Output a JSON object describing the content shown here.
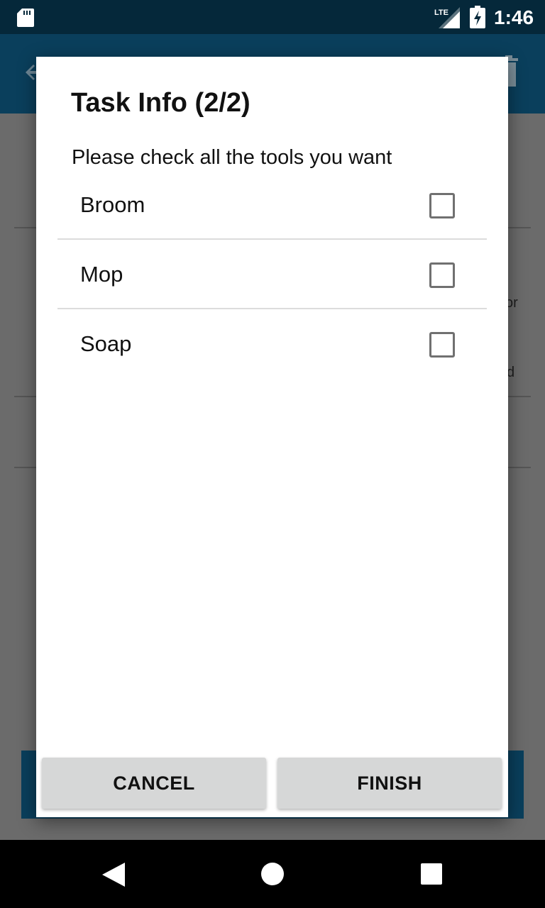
{
  "status_bar": {
    "time": "1:46",
    "network_label": "LTE",
    "icons": [
      "sd-card-icon",
      "lte-signal-icon",
      "battery-charging-icon"
    ]
  },
  "background_app": {
    "partial_texts": [
      "or",
      "d"
    ],
    "icons": [
      "back-arrow-icon",
      "trash-icon"
    ]
  },
  "dialog": {
    "title": "Task Info (2/2)",
    "subtitle": "Please check all the tools you want",
    "tools": [
      {
        "label": "Broom",
        "checked": false
      },
      {
        "label": "Mop",
        "checked": false
      },
      {
        "label": "Soap",
        "checked": false
      }
    ],
    "cancel_label": "CANCEL",
    "finish_label": "FINISH"
  },
  "nav_bar": {
    "icons": [
      "nav-back-icon",
      "nav-home-icon",
      "nav-recents-icon"
    ]
  },
  "colors": {
    "status_bar": "#05283a",
    "toolbar": "#0a3f5c",
    "scrim_background": "#6b6b6b",
    "dialog_background": "#ffffff",
    "button_background": "#d6d7d7",
    "checkbox_border": "#707070"
  }
}
